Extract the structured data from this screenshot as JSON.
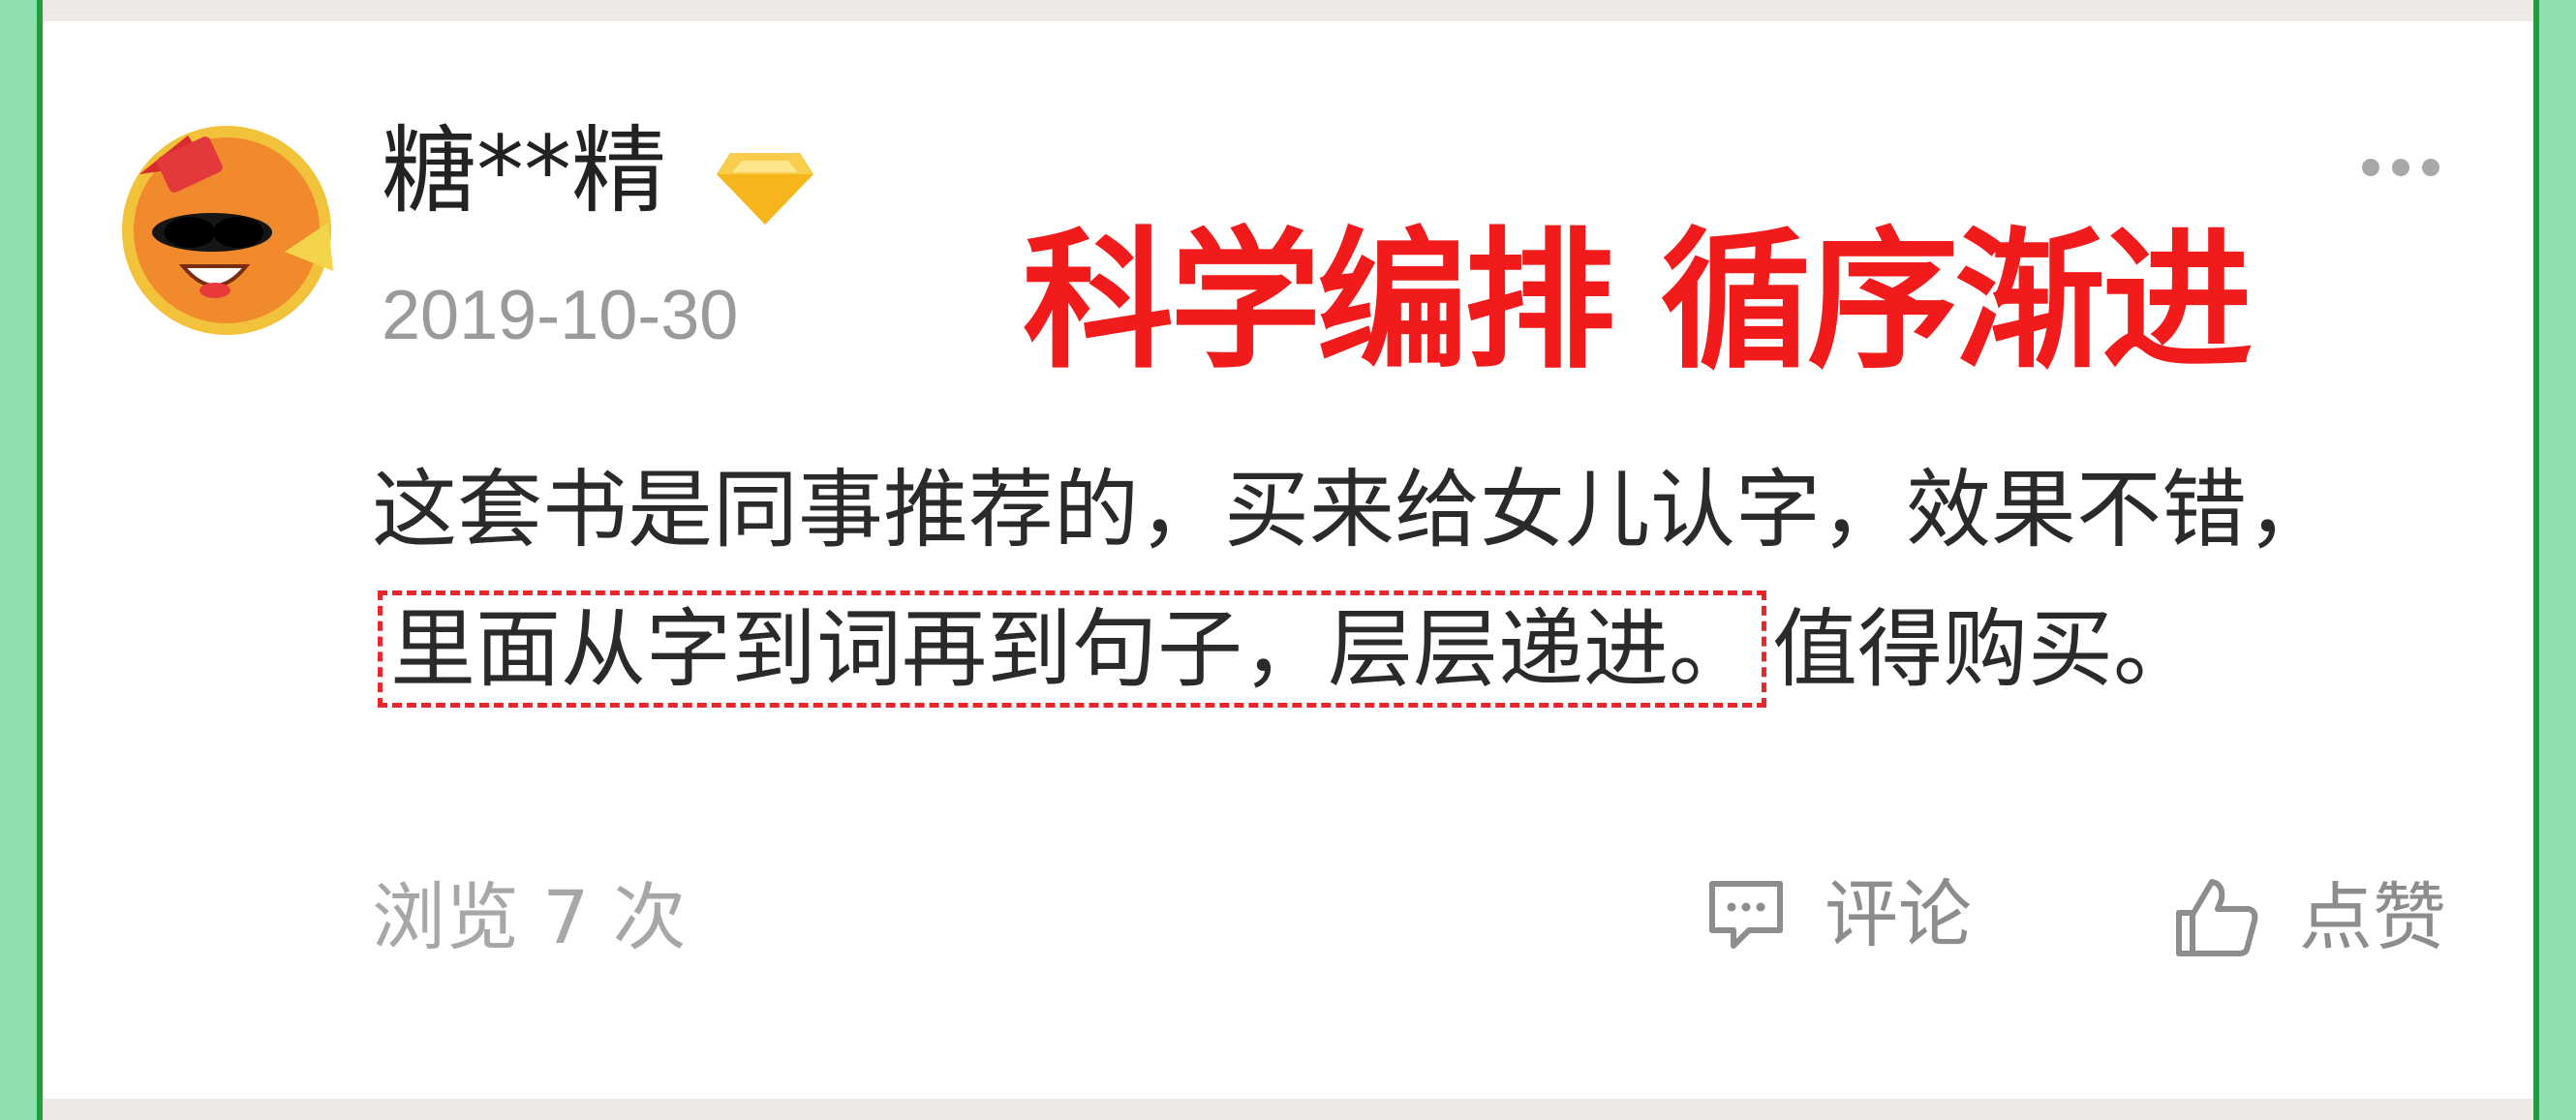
{
  "user": {
    "name": "糖**精",
    "date": "2019-10-30"
  },
  "banner": "科学编排 循序渐进",
  "review": {
    "before": "这套书是同事推荐的，买来给女儿认字，效果不错，",
    "highlight": "里面从字到词再到句子，层层递进。",
    "after": "值得购买。"
  },
  "footer": {
    "views": "浏览 7 次",
    "comment_label": "评论",
    "like_label": "点赞"
  },
  "icons": {
    "avatar": "avatar-sunglasses-mascot",
    "vip": "diamond-icon",
    "more": "more-dots-icon",
    "comment": "comment-icon",
    "like": "thumbs-up-icon"
  },
  "colors": {
    "accent_red": "#f21b1b",
    "frame_green": "#1f9d3f",
    "vip_gold": "#f5b51b"
  }
}
